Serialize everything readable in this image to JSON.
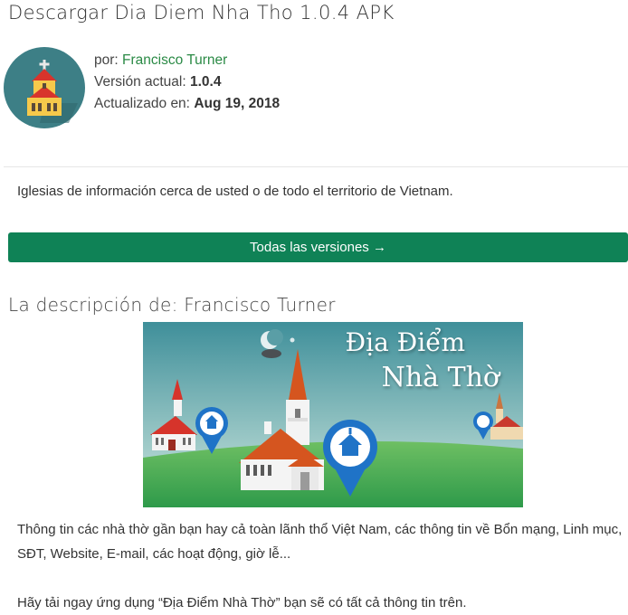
{
  "header": {
    "title": "Descargar Dia Diem Nha Tho 1.0.4 APK"
  },
  "app": {
    "icon": "church-icon",
    "author_label": "por:",
    "author": "Francisco Turner",
    "version_label": "Versión actual:",
    "version": "1.0.4",
    "updated_label": "Actualizado en:",
    "updated": "Aug 19, 2018"
  },
  "summary": "Iglesias de información cerca de usted o de todo el territorio de Vietnam.",
  "versions_button": "Todas las versiones →",
  "description": {
    "heading": "La descripción de: Francisco Turner",
    "banner_title_line1": "Địa Điểm",
    "banner_title_line2": "Nhà Thờ",
    "paragraph1": "Thông tin các nhà thờ gần bạn hay cả toàn lãnh thổ Việt Nam, các thông tin về Bổn mạng, Linh mục, SĐT, Website, E-mail, các hoạt động, giờ lễ...",
    "paragraph2": "Hãy tải ngay ứng dụng “Địa Điểm Nhà Thờ” bạn sẽ có tất cả thông tin trên."
  },
  "colors": {
    "accent_green": "#0f8256",
    "author_link": "#2a8a45",
    "icon_background": "#3d7f86"
  }
}
